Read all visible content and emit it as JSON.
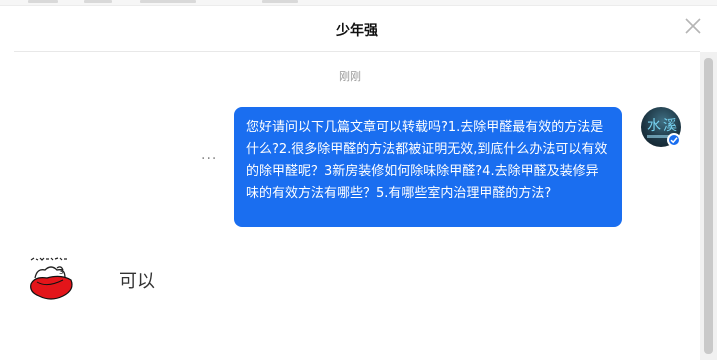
{
  "dialog": {
    "title": "少年强"
  },
  "conversation": {
    "timestamp": "刚刚",
    "messages": [
      {
        "direction": "outgoing",
        "text": "您好请问以下几篇文章可以转载吗?1.去除甲醛最有效的方法是什么?2.很多除甲醛的方法都被证明无效,到底什么办法可以有效的除甲醛呢？3新房装修如何除味除甲醛?4.去除甲醛及装修异味的有效方法有哪些？5.有哪些室内治理甲醛的方法?",
        "more_glyph": "···"
      },
      {
        "direction": "incoming",
        "text": "可以"
      }
    ]
  },
  "icons": {
    "close": "close-icon",
    "more": "more-icon",
    "verified": "verified-badge-icon"
  },
  "colors": {
    "bubble_out": "#1a6ef0",
    "bubble_text": "#ffffff",
    "timestamp": "#999999",
    "incoming_text": "#333333"
  }
}
